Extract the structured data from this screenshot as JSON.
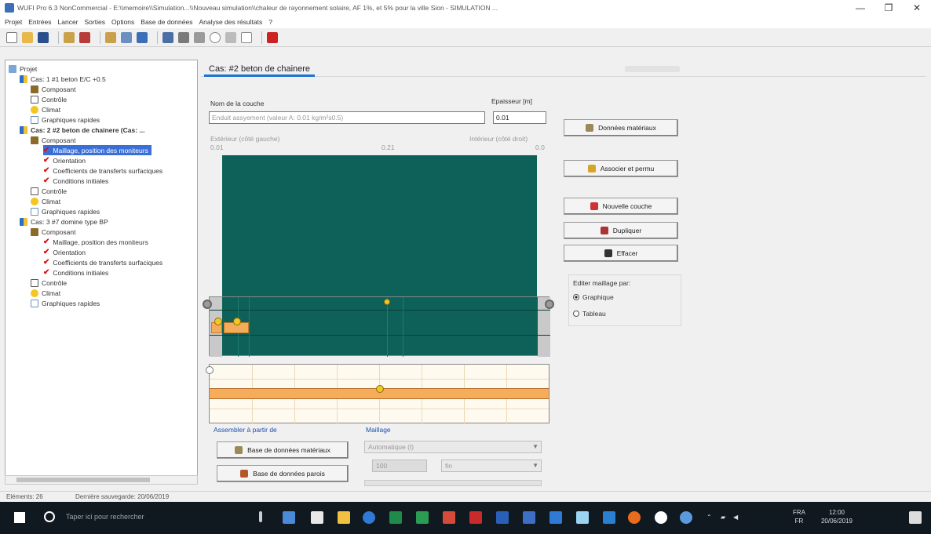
{
  "window": {
    "title": "WUFI Pro 6.3 NonCommercial - E:\\\\memoire\\\\Simulation...\\\\Nouveau simulation\\\\chaleur de rayonnement solaire, AF 1%, et 5% pour la ville Sion - SIMULATION ...",
    "controls": [
      "—",
      "❐",
      "✕"
    ]
  },
  "menubar": [
    "Projet",
    "Entrées",
    "Lancer",
    "Sorties",
    "Options",
    "Base de données",
    "Analyse des résultats",
    "?"
  ],
  "tree": {
    "items": [
      {
        "label": "Projet",
        "icon": "project-icon"
      },
      {
        "label": "Cas: 1 #1 beton E/C +0.5",
        "icon": "case-icon"
      },
      {
        "label": "Composant",
        "icon": "component-icon"
      },
      {
        "label": "Contrôle",
        "icon": "control-icon"
      },
      {
        "label": "Climat",
        "icon": "climate-icon"
      },
      {
        "label": "Graphiques rapides",
        "icon": "graph-icon"
      },
      {
        "label": "Cas: 2 #2 beton de chainere (Cas: ...",
        "icon": "case-icon"
      },
      {
        "label": "Composant",
        "icon": "component-icon"
      },
      {
        "label": "Maillage, position des moniteurs",
        "icon": "check-icon"
      },
      {
        "label": "Orientation",
        "icon": "check-icon"
      },
      {
        "label": "Coefficients de transferts surfaciques",
        "icon": "check-icon"
      },
      {
        "label": "Conditions initiales",
        "icon": "check-icon"
      },
      {
        "label": "Contrôle",
        "icon": "control-icon"
      },
      {
        "label": "Climat",
        "icon": "climate-icon"
      },
      {
        "label": "Graphiques rapides",
        "icon": "graph-icon"
      },
      {
        "label": "Cas: 3 #7 domine type BP",
        "icon": "case-icon"
      },
      {
        "label": "Composant",
        "icon": "component-icon"
      },
      {
        "label": "Maillage, position des moniteurs",
        "icon": "check-icon"
      },
      {
        "label": "Orientation",
        "icon": "check-icon"
      },
      {
        "label": "Coefficients de transferts surfaciques",
        "icon": "check-icon"
      },
      {
        "label": "Conditions initiales",
        "icon": "check-icon"
      },
      {
        "label": "Contrôle",
        "icon": "control-icon"
      },
      {
        "label": "Climat",
        "icon": "climate-icon"
      },
      {
        "label": "Graphiques rapides",
        "icon": "graph-icon"
      }
    ]
  },
  "tab": {
    "label": "Cas: #2 beton de chainere"
  },
  "layer": {
    "name_label": "Nom de la couche",
    "name_value": "Enduit assyement (valeur A: 0.01 kg/m²s0.5)",
    "thickness_label": "Epaisseur [m]",
    "thickness_value": "0.01",
    "left_caption": "Extérieur (côté gauche)",
    "right_caption": "Intérieur (côté droit)",
    "scale_left": "0.01",
    "scale_mid": "0.21",
    "scale_right": "0.0"
  },
  "buttons": {
    "material_data": "Données matériaux",
    "assign_exchange": "Associer et permu",
    "new_layer": "Nouvelle couche",
    "duplicate": "Dupliquer",
    "delete": "Effacer",
    "material_db": "Base de données matériaux",
    "component_db": "Base de données parois"
  },
  "edit": {
    "group_label": "Editer maillage par:",
    "options": [
      "Graphique",
      "Tableau"
    ],
    "selected": "Graphique"
  },
  "bottom": {
    "assemble_label": "Assembler à partir de",
    "mesh_label": "Maillage",
    "mesh_mode": "Automatique (I)",
    "mesh_count": "100",
    "mesh_quality": "fin"
  },
  "status": {
    "left": "Eléments: 26",
    "right": "Dernière sauvegarde: 20/06/2019"
  },
  "taskbar": {
    "search_placeholder": "Taper ici pour rechercher",
    "lang": "FRA",
    "lang2": "FR",
    "time": "12:00",
    "date": "20/06/2019"
  }
}
